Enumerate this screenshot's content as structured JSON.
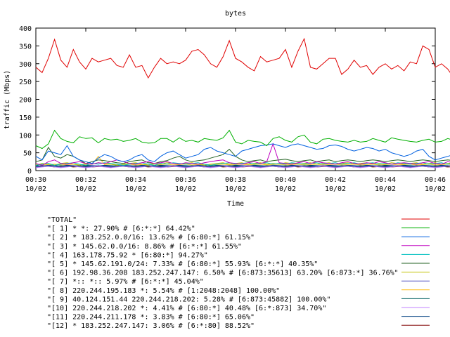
{
  "chart_data": {
    "type": "line",
    "title": "bytes",
    "xlabel": "Time",
    "ylabel": "traffic (Mbps)",
    "ylim": [
      0,
      400
    ],
    "xlim": [
      "00:30",
      "00:46"
    ],
    "y_ticks": [
      0,
      50,
      100,
      150,
      200,
      250,
      300,
      350,
      400
    ],
    "x_ticks": [
      {
        "time": "00:30",
        "date": "10/02"
      },
      {
        "time": "00:32",
        "date": "10/02"
      },
      {
        "time": "00:34",
        "date": "10/02"
      },
      {
        "time": "00:36",
        "date": "10/02"
      },
      {
        "time": "00:38",
        "date": "10/02"
      },
      {
        "time": "00:40",
        "date": "10/02"
      },
      {
        "time": "00:42",
        "date": "10/02"
      },
      {
        "time": "00:44",
        "date": "10/02"
      },
      {
        "time": "00:46",
        "date": "10/02"
      }
    ],
    "grid": false,
    "legend_position": "bottom",
    "x_start": "00:30",
    "x_step_minutes": 0.25,
    "series": [
      {
        "name": "\"TOTAL\"",
        "color": "#e00000",
        "values": [
          290,
          275,
          315,
          368,
          310,
          290,
          340,
          305,
          285,
          315,
          305,
          310,
          315,
          295,
          290,
          325,
          290,
          295,
          260,
          290,
          315,
          300,
          305,
          300,
          310,
          335,
          340,
          325,
          300,
          290,
          320,
          365,
          315,
          305,
          290,
          280,
          320,
          305,
          310,
          315,
          340,
          290,
          335,
          370,
          290,
          285,
          300,
          315,
          315,
          270,
          285,
          310,
          290,
          295,
          270,
          290,
          300,
          285,
          295,
          280,
          305,
          300,
          350,
          340,
          290,
          300,
          285,
          260,
          290,
          295,
          285,
          275,
          270,
          265,
          290,
          290,
          275,
          290,
          265,
          320,
          300,
          385,
          310,
          290,
          290
        ]
      },
      {
        "name": "\"[ 1] * *: 27.90% # [6:*:*] 64.42%\"",
        "color": "#00b000",
        "values": [
          70,
          62,
          75,
          113,
          90,
          82,
          78,
          95,
          90,
          92,
          78,
          90,
          86,
          88,
          82,
          85,
          90,
          80,
          77,
          78,
          90,
          90,
          80,
          92,
          82,
          85,
          80,
          90,
          87,
          85,
          92,
          113,
          80,
          75,
          85,
          82,
          80,
          70,
          90,
          95,
          85,
          80,
          95,
          100,
          80,
          75,
          88,
          90,
          85,
          82,
          80,
          85,
          80,
          82,
          90,
          85,
          80,
          92,
          88,
          85,
          82,
          80,
          85,
          88,
          80,
          82,
          90,
          85,
          80,
          75,
          85,
          95,
          90,
          80,
          82,
          88,
          100,
          95,
          80,
          88,
          85,
          80,
          110,
          105,
          85
        ]
      },
      {
        "name": "\"[ 2] * 183.252.0.0/16: 13.62% # [6:80:*] 61.15%\"",
        "color": "#0060e0",
        "values": [
          40,
          30,
          55,
          50,
          45,
          70,
          40,
          30,
          25,
          20,
          35,
          45,
          40,
          30,
          25,
          30,
          40,
          45,
          30,
          25,
          40,
          50,
          55,
          45,
          35,
          40,
          45,
          60,
          65,
          55,
          50,
          45,
          40,
          55,
          60,
          65,
          70,
          72,
          75,
          70,
          65,
          72,
          75,
          70,
          65,
          60,
          62,
          70,
          72,
          68,
          60,
          55,
          60,
          65,
          62,
          55,
          60,
          50,
          45,
          40,
          45,
          55,
          60,
          40,
          30,
          35,
          40,
          45,
          60,
          50,
          40,
          35,
          40,
          35,
          45,
          40,
          35,
          30,
          40,
          45,
          50,
          45,
          50,
          60,
          40
        ]
      },
      {
        "name": "\"[ 3] * 145.62.0.0/16: 8.86% # [6:*:*] 61.55%\"",
        "color": "#c000c0",
        "values": [
          20,
          15,
          25,
          30,
          20,
          18,
          22,
          25,
          20,
          18,
          22,
          20,
          25,
          30,
          25,
          20,
          18,
          22,
          25,
          20,
          22,
          25,
          20,
          18,
          22,
          20,
          18,
          22,
          25,
          28,
          30,
          22,
          20,
          18,
          22,
          25,
          20,
          25,
          75,
          22,
          20,
          18,
          22,
          25,
          20,
          25,
          22,
          20,
          18,
          22,
          25,
          20,
          18,
          22,
          20,
          25,
          22,
          18,
          20,
          22,
          20,
          18,
          22,
          25,
          20,
          18,
          25,
          22,
          18,
          20,
          22,
          25,
          20,
          18,
          22,
          25,
          20,
          18,
          22,
          20,
          25,
          95,
          22,
          20,
          25
        ]
      },
      {
        "name": "\"[ 4] 163.178.75.92 * [6:80:*] 94.27%\"",
        "color": "#00c0c0",
        "values": [
          15,
          18,
          20,
          15,
          18,
          20,
          22,
          18,
          15,
          20,
          18,
          22,
          20,
          18,
          15,
          18,
          20,
          22,
          18,
          15,
          20,
          18,
          22,
          20,
          18,
          20,
          22,
          18,
          15,
          18,
          20,
          22,
          18,
          20,
          22,
          18,
          20,
          22,
          18,
          20,
          18,
          22,
          20,
          18,
          20,
          22,
          18,
          20,
          22,
          18,
          20,
          22,
          18,
          20,
          22,
          18,
          20,
          18,
          22,
          20,
          18,
          20,
          22,
          18,
          20,
          22,
          18,
          20,
          22,
          18,
          20,
          18,
          22,
          20,
          18,
          20,
          22,
          18,
          20,
          22,
          18,
          20,
          22,
          18,
          20
        ]
      },
      {
        "name": "\"[ 5] * 145.62.191.0/24: 7.33% # [6:80:*] 55.93% [6:*:*] 40.35%\"",
        "color": "#206020",
        "values": [
          25,
          30,
          65,
          40,
          35,
          45,
          40,
          30,
          20,
          25,
          30,
          28,
          25,
          22,
          20,
          25,
          28,
          30,
          22,
          20,
          25,
          28,
          35,
          40,
          30,
          25,
          28,
          30,
          35,
          40,
          45,
          60,
          40,
          30,
          25,
          28,
          30,
          25,
          28,
          30,
          32,
          28,
          25,
          28,
          30,
          25,
          28,
          30,
          25,
          28,
          30,
          28,
          25,
          28,
          30,
          28,
          25,
          28,
          30,
          28,
          25,
          28,
          30,
          28,
          25,
          28,
          30,
          28,
          25,
          28,
          30,
          28,
          25,
          28,
          30,
          28,
          25,
          28,
          30,
          28,
          25,
          28,
          30,
          28,
          25
        ]
      },
      {
        "name": "\"[ 6] 192.98.36.208 183.252.247.147: 6.50% # [6:873:35613] 63.20% [6:873:*] 36.76%\"",
        "color": "#c0c000",
        "values": [
          15,
          20,
          18,
          15,
          20,
          22,
          18,
          15,
          20,
          18,
          22,
          20,
          18,
          15,
          18,
          20,
          22,
          18,
          15,
          20,
          18,
          22,
          20,
          18,
          20,
          22,
          18,
          15,
          18,
          20,
          22,
          18,
          20,
          22,
          18,
          20,
          22,
          18,
          20,
          18,
          22,
          20,
          18,
          20,
          22,
          18,
          20,
          22,
          18,
          20,
          22,
          18,
          20,
          22,
          18,
          20,
          18,
          22,
          20,
          18,
          20,
          22,
          18,
          20,
          22,
          18,
          20,
          22,
          18,
          20,
          18,
          22,
          20,
          18,
          20,
          22,
          18,
          20,
          22,
          18,
          20,
          22,
          18,
          20,
          18
        ]
      },
      {
        "name": "\"[ 7] *:: *:: 5.97% # [6:*:*] 45.04%\"",
        "color": "#5050c0",
        "values": [
          10,
          12,
          14,
          12,
          10,
          12,
          14,
          12,
          10,
          12,
          14,
          12,
          10,
          12,
          14,
          12,
          10,
          12,
          14,
          12,
          10,
          12,
          14,
          12,
          10,
          12,
          14,
          12,
          10,
          12,
          14,
          12,
          10,
          12,
          14,
          12,
          10,
          12,
          14,
          12,
          10,
          12,
          14,
          12,
          10,
          12,
          14,
          12,
          10,
          12,
          14,
          12,
          10,
          12,
          14,
          12,
          10,
          12,
          14,
          12,
          10,
          12,
          14,
          12,
          10,
          12,
          14,
          12,
          10,
          12,
          14,
          12,
          10,
          12,
          14,
          12,
          10,
          12,
          14,
          12,
          10,
          12,
          14,
          12,
          10
        ]
      },
      {
        "name": "\"[ 8] 220.244.195.183 *: 5.54% # [1:2048:2048] 100.00%\"",
        "color": "#ffc020",
        "values": [
          18,
          16,
          17,
          18,
          16,
          17,
          18,
          16,
          17,
          18,
          40,
          17,
          18,
          16,
          17,
          18,
          16,
          17,
          18,
          16,
          17,
          18,
          16,
          17,
          18,
          16,
          17,
          18,
          16,
          17,
          18,
          16,
          17,
          18,
          16,
          17,
          18,
          16,
          17,
          18,
          16,
          17,
          18,
          16,
          17,
          18,
          16,
          17,
          18,
          16,
          17,
          18,
          16,
          17,
          18,
          16,
          17,
          18,
          16,
          17,
          18,
          16,
          17,
          18,
          16,
          17,
          18,
          16,
          17,
          18,
          16,
          17,
          18,
          16,
          17,
          18,
          16,
          17,
          18,
          16,
          17,
          18,
          16,
          17,
          18
        ]
      },
      {
        "name": "\"[ 9] 40.124.151.44 220.244.218.202: 5.28% # [6:873:45882] 100.00%\"",
        "color": "#006060",
        "values": [
          12,
          14,
          13,
          12,
          14,
          13,
          12,
          14,
          13,
          12,
          14,
          13,
          12,
          14,
          13,
          12,
          14,
          13,
          12,
          14,
          13,
          12,
          14,
          13,
          12,
          14,
          13,
          12,
          14,
          13,
          12,
          14,
          13,
          12,
          14,
          13,
          12,
          14,
          13,
          12,
          14,
          13,
          12,
          14,
          13,
          12,
          14,
          13,
          12,
          14,
          13,
          12,
          14,
          13,
          12,
          14,
          13,
          12,
          14,
          13,
          12,
          14,
          13,
          12,
          14,
          13,
          12,
          14,
          13,
          12,
          14,
          13,
          12,
          14,
          13,
          12,
          14,
          13,
          12,
          14,
          13,
          12,
          14,
          13,
          12
        ]
      },
      {
        "name": "\"[10] 220.244.218.202 *: 4.41% # [6:80:*] 40.48% [6:*:873] 34.70%\"",
        "color": "#c080ff",
        "values": [
          8,
          10,
          12,
          10,
          8,
          10,
          12,
          10,
          8,
          10,
          12,
          10,
          8,
          10,
          12,
          10,
          8,
          10,
          12,
          10,
          8,
          10,
          12,
          10,
          8,
          10,
          12,
          10,
          8,
          10,
          12,
          10,
          8,
          10,
          12,
          10,
          8,
          10,
          12,
          10,
          8,
          10,
          12,
          10,
          8,
          10,
          12,
          10,
          8,
          10,
          12,
          10,
          8,
          10,
          12,
          10,
          8,
          10,
          12,
          10,
          8,
          10,
          12,
          10,
          8,
          10,
          12,
          10,
          8,
          10,
          12,
          10,
          8,
          10,
          12,
          10,
          8,
          10,
          12,
          10,
          8,
          10,
          12,
          10,
          8
        ]
      },
      {
        "name": "\"[11] 220.244.211.178 *: 3.83% # [6:80:*] 65.06%\"",
        "color": "#004080",
        "values": [
          14,
          13,
          15,
          14,
          13,
          15,
          14,
          13,
          15,
          14,
          13,
          15,
          14,
          13,
          15,
          14,
          13,
          15,
          14,
          13,
          15,
          14,
          13,
          15,
          14,
          13,
          15,
          14,
          13,
          15,
          14,
          13,
          15,
          14,
          13,
          15,
          14,
          13,
          15,
          14,
          13,
          15,
          14,
          13,
          15,
          14,
          13,
          15,
          14,
          13,
          15,
          14,
          13,
          15,
          14,
          13,
          15,
          14,
          13,
          15,
          14,
          13,
          15,
          14,
          13,
          15,
          14,
          13,
          15,
          14,
          13,
          15,
          14,
          13,
          15,
          14,
          13,
          15,
          14,
          13,
          15,
          14,
          13,
          15,
          14
        ]
      },
      {
        "name": "\"[12] * 183.252.247.147: 3.06% # [6:*:80] 88.52%\"",
        "color": "#800000",
        "values": [
          10,
          11,
          12,
          10,
          11,
          12,
          10,
          11,
          12,
          10,
          11,
          12,
          10,
          11,
          12,
          10,
          11,
          12,
          10,
          11,
          12,
          10,
          11,
          12,
          10,
          11,
          12,
          10,
          11,
          12,
          10,
          11,
          12,
          10,
          11,
          12,
          10,
          11,
          12,
          10,
          11,
          12,
          10,
          11,
          12,
          10,
          11,
          12,
          10,
          11,
          12,
          10,
          11,
          12,
          10,
          11,
          12,
          10,
          11,
          12,
          10,
          11,
          12,
          10,
          11,
          12,
          10,
          11,
          12,
          10,
          11,
          12,
          10,
          11,
          12,
          10,
          11,
          12,
          10,
          11,
          12,
          10,
          11,
          12,
          10
        ]
      }
    ]
  }
}
